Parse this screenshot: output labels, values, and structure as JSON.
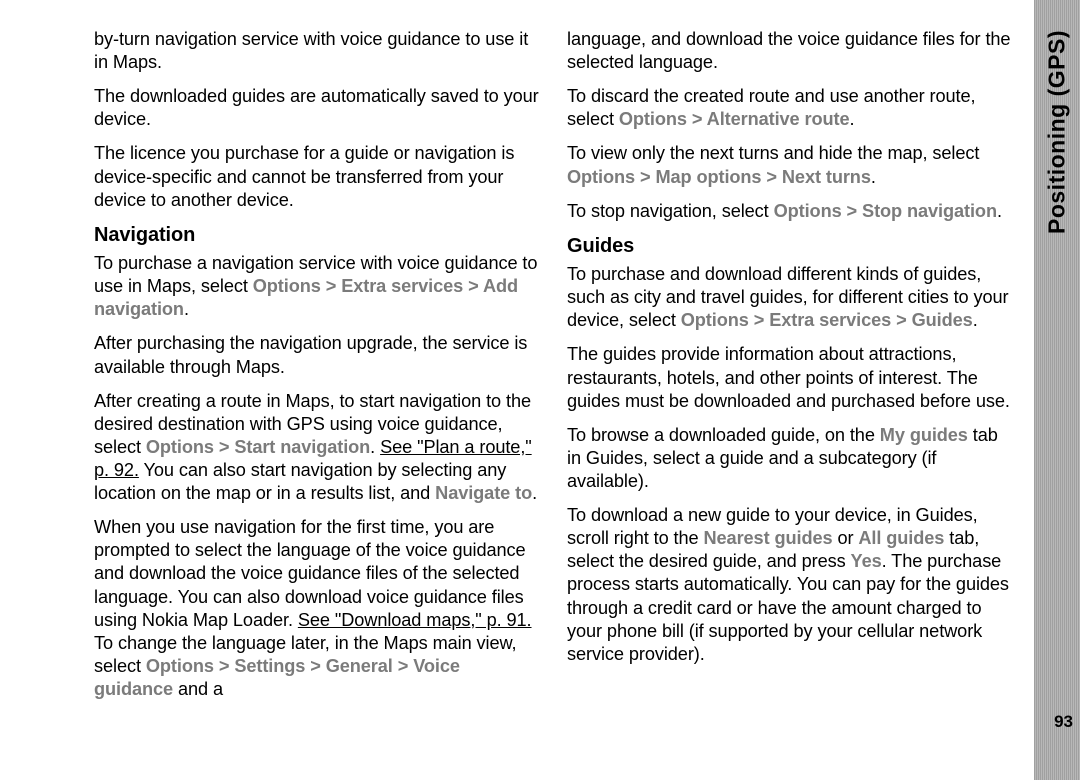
{
  "section_label": "Positioning (GPS)",
  "page_number": "93",
  "left": {
    "p1": {
      "a": "by-turn navigation service with voice guidance to use it in Maps."
    },
    "p2": {
      "a": "The downloaded guides are automatically saved to your device."
    },
    "p3": {
      "a": "The licence you purchase for a guide or navigation is device-specific and cannot be transferred from your device to another device."
    },
    "h1": "Navigation",
    "p4": {
      "a": "To purchase a navigation service with voice guidance to use in Maps, select ",
      "b": "Options",
      "c": " > ",
      "d": "Extra services",
      "e": " > ",
      "f": "Add navigation",
      "g": "."
    },
    "p5": {
      "a": "After purchasing the navigation upgrade, the service is available through Maps."
    },
    "p6": {
      "a": "After creating a route in Maps, to start navigation to the desired destination with GPS using voice guidance, select ",
      "b": "Options",
      "c": " > ",
      "d": "Start navigation",
      "e": ". ",
      "f": "See \"Plan a route,\" p. 92.",
      "g": " You can also start navigation by selecting any location on the map or in a results list, and ",
      "h": "Navigate to",
      "i": "."
    },
    "p7": {
      "a": "When you use navigation for the first time, you are prompted to select the language of the voice guidance and download the voice guidance files of the selected language. You can also download voice guidance files using Nokia Map Loader. ",
      "b": "See \"Download maps,\" p. 91.",
      "c": " To change the language later, in the Maps main view, select ",
      "d": "Options",
      "e": " > ",
      "f": "Settings",
      "g": " > ",
      "h": "General",
      "i": " > ",
      "j": "Voice guidance",
      "k": " and a"
    }
  },
  "right": {
    "p1": {
      "a": "language, and download the voice guidance files for the selected language."
    },
    "p2": {
      "a": "To discard the created route and use another route, select ",
      "b": "Options",
      "c": " > ",
      "d": "Alternative route",
      "e": "."
    },
    "p3": {
      "a": "To view only the next turns and hide the map, select ",
      "b": "Options",
      "c": " > ",
      "d": "Map options",
      "e": " > ",
      "f": "Next turns",
      "g": "."
    },
    "p4": {
      "a": "To stop navigation, select ",
      "b": "Options",
      "c": " > ",
      "d": "Stop navigation",
      "e": "."
    },
    "h1": "Guides",
    "p5": {
      "a": "To purchase and download different kinds of guides, such as city and travel guides, for different cities to your device, select ",
      "b": "Options",
      "c": " > ",
      "d": "Extra services",
      "e": " > ",
      "f": "Guides",
      "g": "."
    },
    "p6": {
      "a": "The guides provide information about attractions, restaurants, hotels, and other points of interest. The guides must be downloaded and purchased before use."
    },
    "p7": {
      "a": "To browse a downloaded guide, on the ",
      "b": "My guides",
      "c": " tab in Guides, select a guide and a subcategory (if available)."
    },
    "p8": {
      "a": "To download a new guide to your device, in Guides, scroll right to the ",
      "b": "Nearest guides",
      "c": " or ",
      "d": "All guides",
      "e": " tab, select the desired guide, and press ",
      "f": "Yes",
      "g": ". The purchase process starts automatically. You can pay for the guides through a credit card or have the amount charged to your phone bill (if supported by your cellular network service provider)."
    }
  }
}
